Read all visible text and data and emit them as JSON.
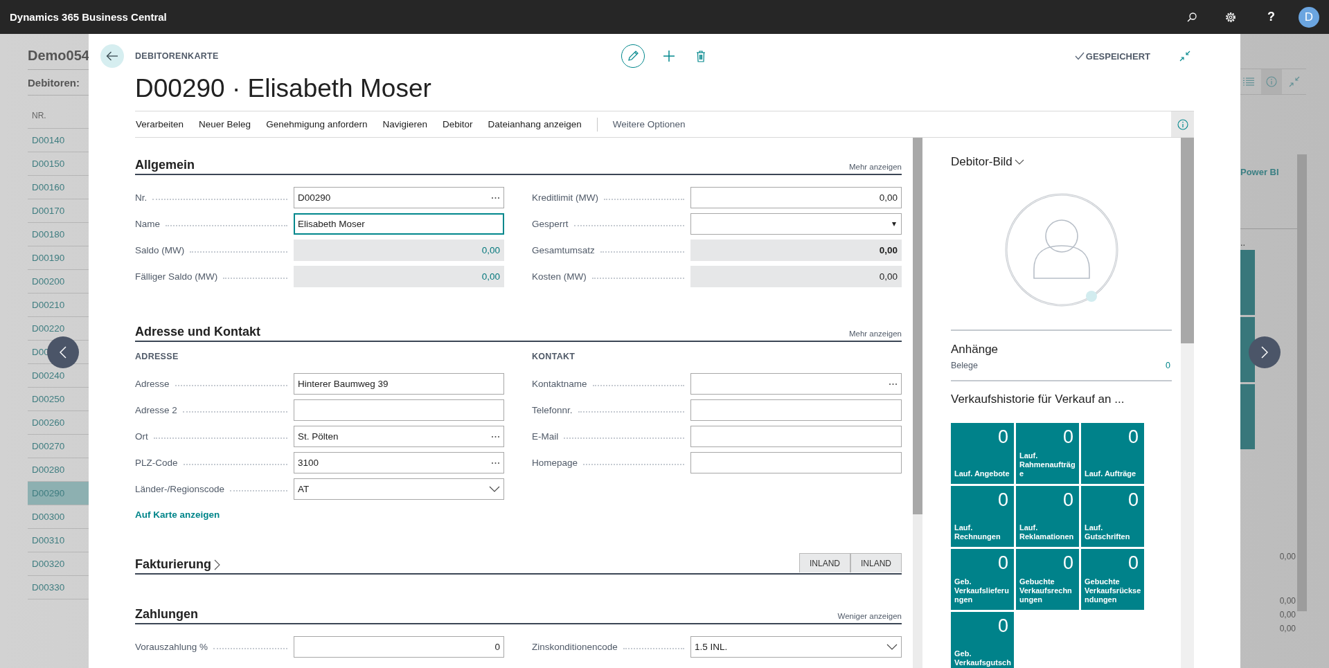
{
  "app_bar": {
    "title": "Dynamics 365 Business Central",
    "help": "?",
    "avatar": "D"
  },
  "background": {
    "company": "Demo054",
    "list_title": "Debitoren:",
    "column": "NR.",
    "rows": [
      {
        "no": "D00140",
        "selected": false
      },
      {
        "no": "D00150",
        "selected": false
      },
      {
        "no": "D00160",
        "selected": false
      },
      {
        "no": "D00170",
        "selected": false
      },
      {
        "no": "D00180",
        "selected": false
      },
      {
        "no": "D00190",
        "selected": false
      },
      {
        "no": "D00200",
        "selected": false
      },
      {
        "no": "D00210",
        "selected": false
      },
      {
        "no": "D00220",
        "selected": false
      },
      {
        "no": "D00",
        "selected": false
      },
      {
        "no": "D00240",
        "selected": false
      },
      {
        "no": "D00250",
        "selected": false
      },
      {
        "no": "D00260",
        "selected": false
      },
      {
        "no": "D00270",
        "selected": false
      },
      {
        "no": "D00280",
        "selected": false
      },
      {
        "no": "D00290",
        "selected": true
      },
      {
        "no": "D00300",
        "selected": false
      },
      {
        "no": "D00310",
        "selected": false
      },
      {
        "no": "D00320",
        "selected": false
      },
      {
        "no": "D00330",
        "selected": false
      }
    ],
    "side": {
      "title": "Power BI",
      "more": "..",
      "values": [
        "0,00",
        "0,00",
        "0,00",
        "0,00"
      ]
    }
  },
  "dialog": {
    "caption": "DEBITORENKARTE",
    "title": "D00290 · Elisabeth Moser",
    "status": "GESPEICHERT",
    "actions": [
      {
        "label": "Verarbeiten",
        "kind": "action"
      },
      {
        "label": "Neuer Beleg",
        "kind": "action"
      },
      {
        "label": "Genehmigung anfordern",
        "kind": "action"
      },
      {
        "label": "Navigieren",
        "kind": "action"
      },
      {
        "label": "Debitor",
        "kind": "action"
      },
      {
        "label": "Dateianhang anzeigen",
        "kind": "action"
      },
      {
        "label": "Weitere Optionen",
        "kind": "more"
      }
    ],
    "sections": [
      {
        "title": "Allgemein",
        "expanded": true,
        "toggle": "Mehr anzeigen",
        "columns": [
          {
            "fields": [
              {
                "label": "Nr.",
                "value": "D00290",
                "kind": "lookup",
                "focused": false
              },
              {
                "label": "Name",
                "value": "Elisabeth Moser",
                "kind": "text",
                "focused": true
              },
              {
                "label": "Saldo (MW)",
                "value": "0,00",
                "kind": "readonly",
                "link": true,
                "bold": false,
                "focused": false
              },
              {
                "label": "Fälliger Saldo (MW)",
                "value": "0,00",
                "kind": "readonly",
                "link": true,
                "bold": false,
                "focused": false
              }
            ]
          },
          {
            "fields": [
              {
                "label": "Kreditlimit (MW)",
                "value": "0,00",
                "kind": "number",
                "focused": false
              },
              {
                "label": "Gesperrt",
                "kind": "dropdown",
                "focused": false
              },
              {
                "label": "Gesamtumsatz",
                "value": "0,00",
                "kind": "readonly",
                "link": false,
                "bold": true,
                "focused": false
              },
              {
                "label": "Kosten (MW)",
                "value": "0,00",
                "kind": "readonly",
                "link": false,
                "bold": false,
                "focused": false
              }
            ]
          }
        ]
      },
      {
        "title": "Adresse und Kontakt",
        "expanded": true,
        "toggle": "Mehr anzeigen",
        "link": "Auf Karte anzeigen",
        "columns": [
          {
            "heading": "ADRESSE",
            "fields": [
              {
                "label": "Adresse",
                "value": "Hinterer Baumweg 39",
                "kind": "text",
                "focused": false
              },
              {
                "label": "Adresse 2",
                "kind": "text",
                "focused": false
              },
              {
                "label": "Ort",
                "value": "St. Pölten",
                "kind": "lookup",
                "focused": false
              },
              {
                "label": "PLZ-Code",
                "value": "3100",
                "kind": "lookup",
                "focused": false
              },
              {
                "label": "Länder-/Regionscode",
                "value": "AT",
                "kind": "select",
                "focused": false
              }
            ]
          },
          {
            "heading": "KONTAKT",
            "fields": [
              {
                "label": "Kontaktname",
                "kind": "lookup",
                "focused": false
              },
              {
                "label": "Telefonnr.",
                "kind": "text",
                "focused": false
              },
              {
                "label": "E-Mail",
                "kind": "text",
                "focused": false
              },
              {
                "label": "Homepage",
                "kind": "text",
                "focused": false
              }
            ]
          }
        ]
      },
      {
        "title": "Fakturierung",
        "expanded": false,
        "summary": [
          "INLAND",
          "INLAND"
        ]
      },
      {
        "title": "Zahlungen",
        "expanded": true,
        "toggle": "Weniger anzeigen",
        "columns": [
          {
            "fields": [
              {
                "label": "Vorauszahlung %",
                "value": "0",
                "kind": "number",
                "focused": false
              }
            ]
          },
          {
            "fields": [
              {
                "label": "Zinskonditionencode",
                "value": "1.5 INL.",
                "kind": "select",
                "focused": false
              }
            ]
          }
        ]
      }
    ],
    "factbox": {
      "picture_title": "Debitor-Bild",
      "attachments_title": "Anhänge",
      "attachments_label": "Belege",
      "attachments_count": "0",
      "history_title": "Verkaufshistorie für Verkauf an ...",
      "tiles": [
        {
          "count": "0",
          "label": "Lauf. Angebote"
        },
        {
          "count": "0",
          "label": "Lauf. Rahmenaufträge"
        },
        {
          "count": "0",
          "label": "Lauf. Aufträge"
        },
        {
          "count": "0",
          "label": "Lauf. Rechnungen"
        },
        {
          "count": "0",
          "label": "Lauf. Reklamationen"
        },
        {
          "count": "0",
          "label": "Lauf. Gutschriften"
        },
        {
          "count": "0",
          "label": "Geb. Verkaufslieferungen"
        },
        {
          "count": "0",
          "label": "Gebuchte Verkaufsrechnungen"
        },
        {
          "count": "0",
          "label": "Gebuchte Verkaufsrücksendungen"
        },
        {
          "count": "0",
          "label": "Geb. Verkaufsgutsch"
        }
      ]
    }
  }
}
